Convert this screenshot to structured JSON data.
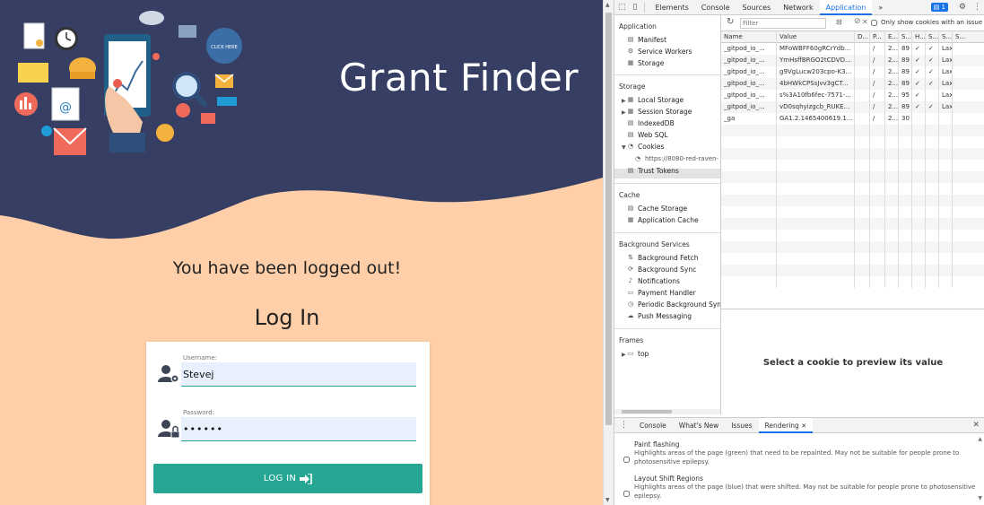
{
  "app": {
    "title": "Grant Finder",
    "logout_message": "You have been logged out!",
    "login_heading": "Log In",
    "click_here": "CLICK HERE",
    "username_label": "Username:",
    "username_value": "Stevej",
    "password_label": "Password:",
    "password_value": "••••••",
    "login_button": "LOG IN",
    "colors": {
      "header_bg": "#363f63",
      "page_bg": "#fecfa8",
      "accent": "#26a693"
    }
  },
  "devtools": {
    "tabs": [
      "Elements",
      "Console",
      "Sources",
      "Network",
      "Application"
    ],
    "active_tab": "Application",
    "more": "»",
    "issues_badge": "1",
    "sidebar": {
      "application_header": "Application",
      "application_items": [
        "Manifest",
        "Service Workers",
        "Storage"
      ],
      "storage_header": "Storage",
      "storage_items": [
        "Local Storage",
        "Session Storage",
        "IndexedDB",
        "Web SQL",
        "Cookies"
      ],
      "cookie_origin": "https://8080-red-raven-",
      "trust_tokens": "Trust Tokens",
      "cache_header": "Cache",
      "cache_items": [
        "Cache Storage",
        "Application Cache"
      ],
      "bg_header": "Background Services",
      "bg_items": [
        "Background Fetch",
        "Background Sync",
        "Notifications",
        "Payment Handler",
        "Periodic Background Sync",
        "Push Messaging"
      ],
      "frames_header": "Frames",
      "frames_items": [
        "top"
      ]
    },
    "filter_placeholder": "Filter",
    "only_issue_label": "Only show cookies with an issue",
    "columns": [
      "Name",
      "Value",
      "D...",
      "P...",
      "E...",
      "S...",
      "H...",
      "S...",
      "S...",
      "S..."
    ],
    "cookies": [
      [
        "_gitpod_io_...",
        "MFoWBFF60gRCrYdb...",
        "",
        "/",
        "2...",
        "89",
        "✓",
        "✓",
        "Lax",
        ""
      ],
      [
        "_gitpod_io_...",
        "YmHsffBRGO2tCDVD...",
        "",
        "/",
        "2...",
        "89",
        "✓",
        "✓",
        "Lax",
        ""
      ],
      [
        "_gitpod_io_...",
        "g9VgLucw203cpo-K3...",
        "",
        "/",
        "2...",
        "89",
        "✓",
        "✓",
        "Lax",
        ""
      ],
      [
        "_gitpod_io_...",
        "4bHWkCPSsJvv3gCT...",
        "",
        "/",
        "2...",
        "89",
        "✓",
        "✓",
        "Lax",
        ""
      ],
      [
        "_gitpod_io_...",
        "s%3A10fb6fec-7571-...",
        "",
        "/",
        "2...",
        "95",
        "✓",
        "",
        "Lax",
        ""
      ],
      [
        "_gitpod_io_...",
        "vD0sqhyizgcb_RUKE...",
        "",
        "/",
        "2...",
        "89",
        "✓",
        "✓",
        "Lax",
        ""
      ],
      [
        "_ga",
        "GA1.2.1465400619.1...",
        "",
        "/",
        "2...",
        "30",
        "",
        "",
        "",
        ""
      ]
    ],
    "preview_message": "Select a cookie to preview its value",
    "drawer_tabs": [
      "Console",
      "What's New",
      "Issues",
      "Rendering"
    ],
    "drawer_active": "Rendering",
    "rendering": [
      {
        "title": "Paint flashing",
        "desc": "Highlights areas of the page (green) that need to be repainted. May not be suitable for people prone to photosensitive epilepsy."
      },
      {
        "title": "Layout Shift Regions",
        "desc": "Highlights areas of the page (blue) that were shifted. May not be suitable for people prone to photosensitive epilepsy."
      }
    ]
  }
}
